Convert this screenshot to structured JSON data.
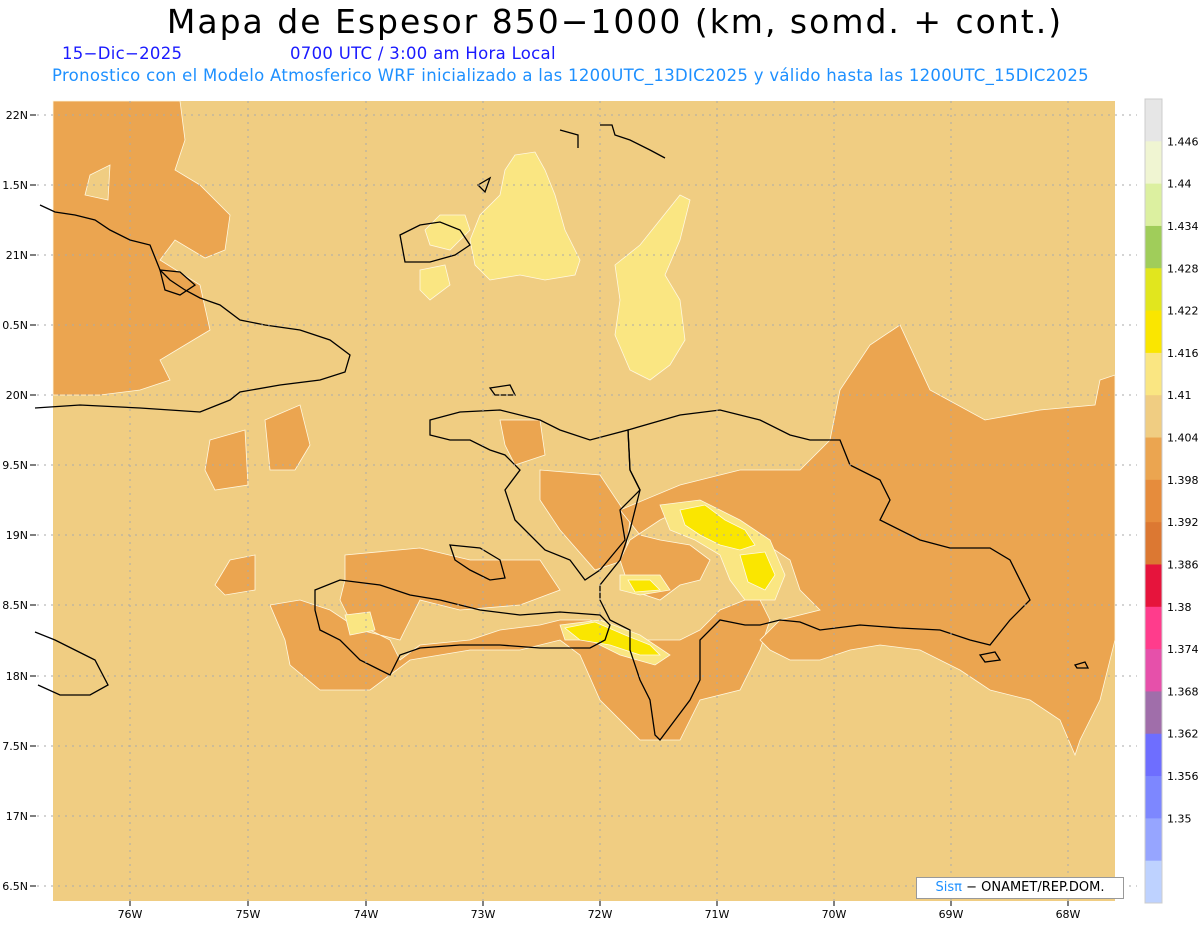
{
  "title": "Mapa de Espesor 850−1000 (km, somd. + cont.)",
  "date": "15−Dic−2025",
  "time": "0700 UTC / 3:00 am Hora Local",
  "info": "Pronostico con el Modelo Atmosferico WRF inicializado a las 1200UTC_13DIC2025 y válido hasta las  1200UTC_15DIC2025",
  "lat_labels": [
    "22N",
    "1.5N",
    "21N",
    "0.5N",
    "20N",
    "9.5N",
    "19N",
    "8.5N",
    "18N",
    "7.5N",
    "17N",
    "6.5N"
  ],
  "lon_labels": [
    "76W",
    "75W",
    "74W",
    "73W",
    "72W",
    "71W",
    "70W",
    "69W",
    "68W"
  ],
  "colorbar": {
    "labels": [
      "1.446",
      "1.44",
      "1.434",
      "1.428",
      "1.422",
      "1.416",
      "1.41",
      "1.404",
      "1.398",
      "1.392",
      "1.386",
      "1.38",
      "1.374",
      "1.368",
      "1.362",
      "1.356",
      "1.35"
    ],
    "colors": [
      "#e6e6e6",
      "#f0f5d2",
      "#dcf0a0",
      "#a0cd5a",
      "#e1e61e",
      "#fae600",
      "#fae682",
      "#f0cd82",
      "#eba550",
      "#e68c3c",
      "#dc7832",
      "#e6143c",
      "#ff3c8c",
      "#e650aa",
      "#a06eaa",
      "#6e6eff",
      "#7d87ff",
      "#96a5ff",
      "#bed2ff"
    ]
  },
  "credit": {
    "a": "Sisπ",
    "b": "− ONAMET/REP.DOM."
  }
}
